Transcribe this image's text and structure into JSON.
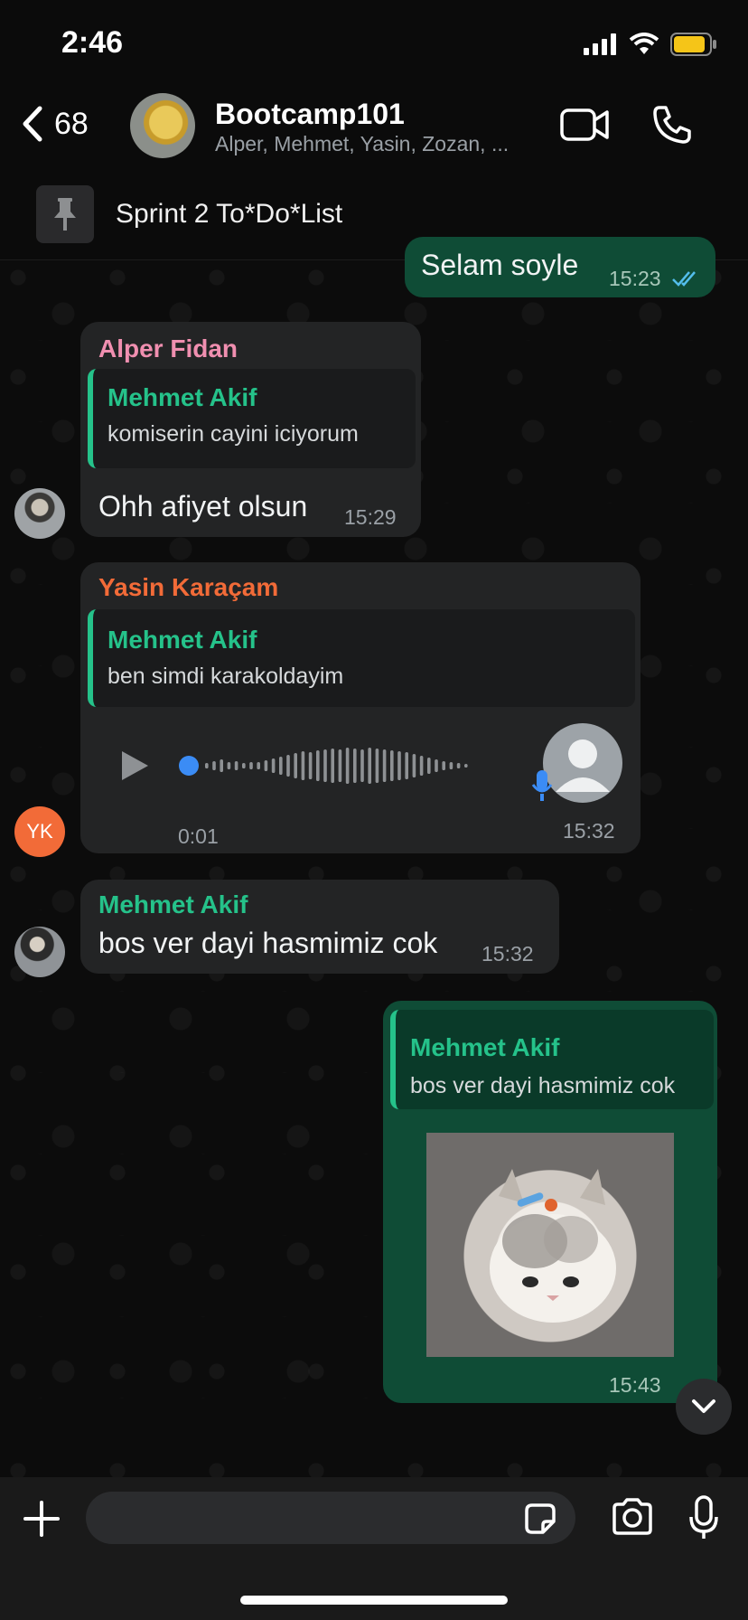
{
  "status_bar": {
    "time": "2:46",
    "battery_color": "#f5c518"
  },
  "header": {
    "back_count": "68",
    "title": "Bootcamp101",
    "subtitle": "Alper, Mehmet, Yasin, Zozan, ...",
    "icons": [
      "video-call-icon",
      "phone-icon"
    ]
  },
  "pinned": {
    "text": "Sprint 2 To*Do*List",
    "icon": "pin-icon"
  },
  "messages": [
    {
      "id": "m0",
      "direction": "out",
      "text": "Selam soyle",
      "time": "15:23",
      "read": true
    },
    {
      "id": "m1",
      "direction": "in",
      "sender": "Alper Fidan",
      "sender_color": "#f08fb0",
      "reply_to": {
        "name": "Mehmet Akif",
        "text": "komiserin cayini iciyorum"
      },
      "text": "Ohh afiyet olsun",
      "time": "15:29"
    },
    {
      "id": "m2",
      "direction": "in",
      "sender": "Yasin Karaçam",
      "sender_color": "#f26b38",
      "avatar_initials": "YK",
      "avatar_color": "#f26b38",
      "reply_to": {
        "name": "Mehmet Akif",
        "text": "ben simdi karakoldayim"
      },
      "voice": {
        "duration": "0:01"
      },
      "time": "15:32"
    },
    {
      "id": "m3",
      "direction": "in",
      "sender": "Mehmet Akif",
      "sender_color": "#25c28a",
      "text": "bos ver dayi hasmimiz cok",
      "time": "15:32"
    },
    {
      "id": "m4",
      "direction": "out",
      "reply_to": {
        "name": "Mehmet Akif",
        "text": "bos ver dayi hasmimiz cok"
      },
      "image": "kitten-photo",
      "time": "15:43",
      "read": true
    }
  ],
  "input": {
    "placeholder": ""
  },
  "accent": {
    "green": "#25c28a",
    "read_tick": "#53bdeb"
  }
}
